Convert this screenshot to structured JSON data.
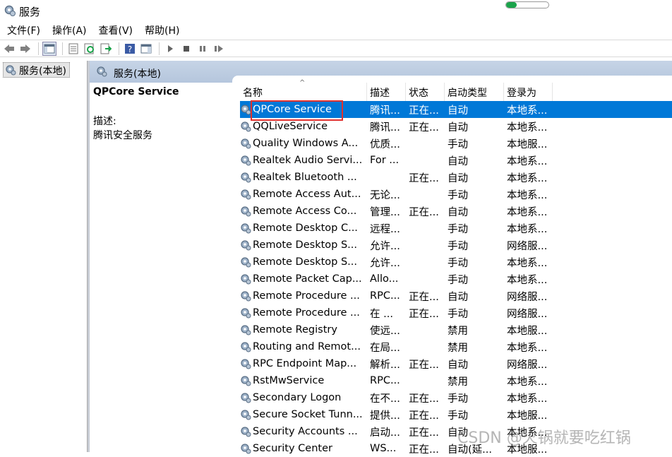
{
  "window": {
    "title": "服务",
    "progress": 0.25
  },
  "menu": [
    "文件(F)",
    "操作(A)",
    "查看(V)",
    "帮助(H)"
  ],
  "tree": {
    "item": "服务(本地)"
  },
  "pane_header": "服务(本地)",
  "details": {
    "name": "QPCore Service",
    "desc_label": "描述:",
    "desc_text": "腾讯安全服务"
  },
  "columns": [
    "名称",
    "描述",
    "状态",
    "启动类型",
    "登录为"
  ],
  "sort_indicator": "^",
  "rows": [
    [
      "QPCore Service",
      "腾讯...",
      "正在...",
      "自动",
      "本地系..."
    ],
    [
      "QQLiveService",
      "腾讯...",
      "正在...",
      "自动",
      "本地系..."
    ],
    [
      "Quality Windows A...",
      "优质...",
      "",
      "手动",
      "本地服..."
    ],
    [
      "Realtek Audio Servi...",
      "For ...",
      "",
      "自动",
      "本地系..."
    ],
    [
      "Realtek Bluetooth ...",
      "",
      "正在...",
      "自动",
      "本地系..."
    ],
    [
      "Remote Access Aut...",
      "无论...",
      "",
      "手动",
      "本地系..."
    ],
    [
      "Remote Access Co...",
      "管理...",
      "正在...",
      "自动",
      "本地系..."
    ],
    [
      "Remote Desktop C...",
      "远程...",
      "",
      "手动",
      "本地系..."
    ],
    [
      "Remote Desktop S...",
      "允许...",
      "",
      "手动",
      "网络服..."
    ],
    [
      "Remote Desktop S...",
      "允许...",
      "",
      "手动",
      "本地系..."
    ],
    [
      "Remote Packet Cap...",
      "Allo...",
      "",
      "手动",
      "本地系..."
    ],
    [
      "Remote Procedure ...",
      "RPC...",
      "正在...",
      "自动",
      "网络服..."
    ],
    [
      "Remote Procedure ...",
      "在 ...",
      "正在...",
      "手动",
      "网络服..."
    ],
    [
      "Remote Registry",
      "使远...",
      "",
      "禁用",
      "本地服..."
    ],
    [
      "Routing and Remot...",
      "在局...",
      "",
      "禁用",
      "本地系..."
    ],
    [
      "RPC Endpoint Map...",
      "解析...",
      "正在...",
      "自动",
      "网络服..."
    ],
    [
      "RstMwService",
      "RPC...",
      "",
      "禁用",
      "本地系..."
    ],
    [
      "Secondary Logon",
      "在不...",
      "正在...",
      "手动",
      "本地系..."
    ],
    [
      "Secure Socket Tunn...",
      "提供...",
      "正在...",
      "手动",
      "本地服..."
    ],
    [
      "Security Accounts ...",
      "启动...",
      "正在...",
      "自动",
      "本地系..."
    ],
    [
      "Security Center",
      "WS...",
      "正在...",
      "自动(延...",
      "本地服..."
    ]
  ],
  "selected_row": 0,
  "watermark": "CSDN @火锅就要吃红锅",
  "colors": {
    "selection": "#0078d7",
    "highlight_box": "#e0322f"
  }
}
